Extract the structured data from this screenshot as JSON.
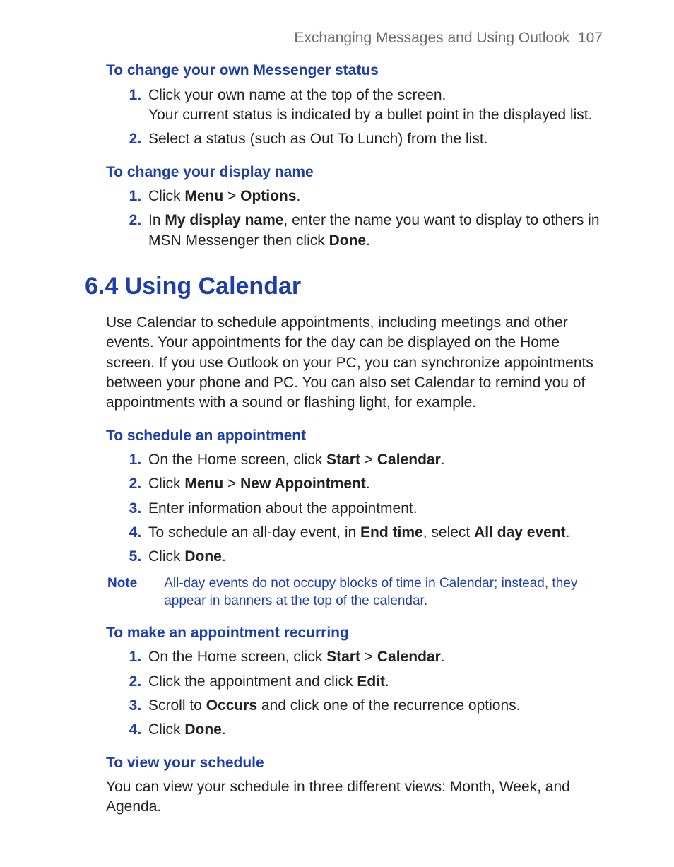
{
  "header": {
    "chapter_title": "Exchanging Messages and Using Outlook",
    "page_number": "107"
  },
  "section_a": {
    "title": "To change your own Messenger status",
    "item1_line1": "Click your own name at the top of the screen.",
    "item1_line2": "Your current status is indicated by a bullet point in the displayed list.",
    "item2": "Select a status (such as Out To Lunch) from the list."
  },
  "section_b": {
    "title": "To change your display name",
    "item1_pre": "Click ",
    "item1_b1": "Menu",
    "item1_mid": " > ",
    "item1_b2": "Options",
    "item1_post": ".",
    "item2_pre": "In ",
    "item2_b1": "My display name",
    "item2_mid": ", enter the name you want to display to others in MSN Messenger then click ",
    "item2_b2": "Done",
    "item2_post": "."
  },
  "heading64": "6.4 Using Calendar",
  "intro64": "Use Calendar to schedule appointments, including meetings and other events. Your appointments for the day can be displayed on the Home screen. If you use Outlook on your PC, you can synchronize appointments between your phone and PC. You can also set Calendar to remind you of appointments with a sound or flashing light, for example.",
  "section_c": {
    "title": "To schedule an appointment",
    "i1_pre": "On the Home screen, click ",
    "i1_b1": "Start",
    "i1_mid": " > ",
    "i1_b2": "Calendar",
    "i1_post": ".",
    "i2_pre": "Click ",
    "i2_b1": "Menu",
    "i2_mid": " > ",
    "i2_b2": "New Appointment",
    "i2_post": ".",
    "i3": "Enter information about the appointment.",
    "i4_pre": "To schedule an all-day event, in ",
    "i4_b1": "End time",
    "i4_mid": ", select ",
    "i4_b2": "All day event",
    "i4_post": ".",
    "i5_pre": "Click ",
    "i5_b1": "Done",
    "i5_post": "."
  },
  "note": {
    "label": "Note",
    "text": "All-day events do not occupy blocks of time in Calendar; instead, they appear in banners at the top of the calendar."
  },
  "section_d": {
    "title": "To make an appointment recurring",
    "i1_pre": "On the Home screen, click ",
    "i1_b1": "Start",
    "i1_mid": " > ",
    "i1_b2": "Calendar",
    "i1_post": ".",
    "i2_pre": "Click the appointment and click ",
    "i2_b1": "Edit",
    "i2_post": ".",
    "i3_pre": "Scroll to ",
    "i3_b1": "Occurs",
    "i3_post": " and click one of the recurrence options.",
    "i4_pre": "Click ",
    "i4_b1": "Done",
    "i4_post": "."
  },
  "section_e": {
    "title": "To view your schedule",
    "text": "You can view your schedule in three different views: Month, Week, and Agenda."
  }
}
